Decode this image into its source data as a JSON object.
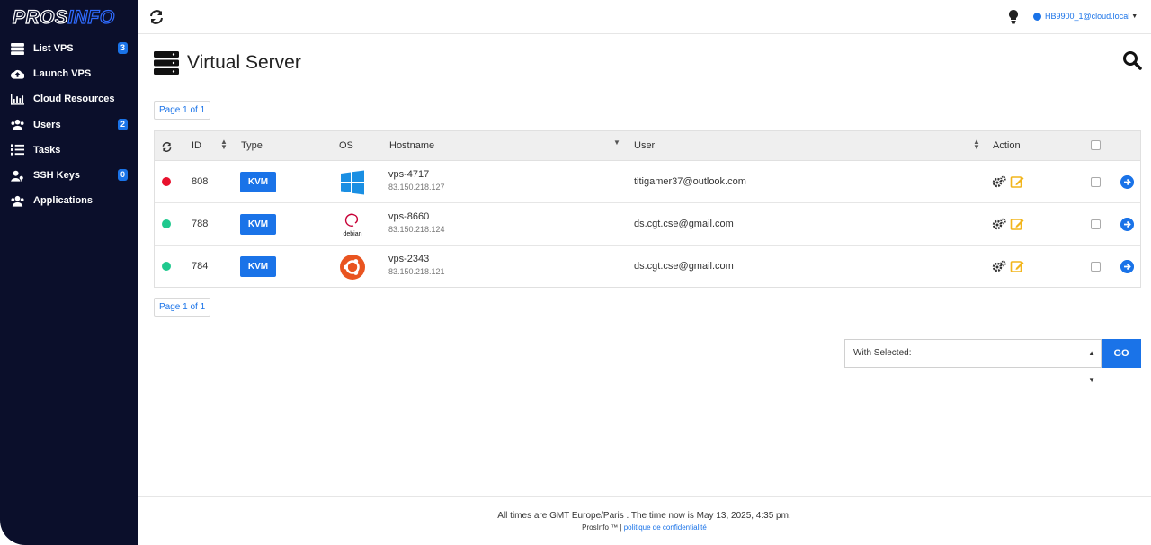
{
  "logo": {
    "part1": "PROS",
    "part2": "INFO"
  },
  "sidebar": {
    "items": [
      {
        "label": "List VPS",
        "icon": "server-icon",
        "badge": "3"
      },
      {
        "label": "Launch VPS",
        "icon": "cloud-upload-icon",
        "badge": ""
      },
      {
        "label": "Cloud Resources",
        "icon": "bar-chart-icon",
        "badge": ""
      },
      {
        "label": "Users",
        "icon": "users-icon",
        "badge": "2"
      },
      {
        "label": "Tasks",
        "icon": "list-icon",
        "badge": ""
      },
      {
        "label": "SSH Keys",
        "icon": "user-key-icon",
        "badge": "0"
      },
      {
        "label": "Applications",
        "icon": "users-icon",
        "badge": ""
      }
    ]
  },
  "topbar": {
    "user": "HB9900_1@cloud.local"
  },
  "page": {
    "title": "Virtual Server"
  },
  "pagination": {
    "top": "Page 1 of 1",
    "bottom": "Page 1 of 1"
  },
  "table": {
    "headers": {
      "id": "ID",
      "type": "Type",
      "os": "OS",
      "hostname": "Hostname",
      "user": "User",
      "action": "Action"
    },
    "rows": [
      {
        "status_color": "#e8112d",
        "id": "808",
        "type": "KVM",
        "os": "windows-logo",
        "hostname": "vps-4717",
        "ip": "83.150.218.127",
        "user": "titigamer37@outlook.com"
      },
      {
        "status_color": "#1fc98e",
        "id": "788",
        "type": "KVM",
        "os": "debian-logo",
        "os_label": "debian",
        "hostname": "vps-8660",
        "ip": "83.150.218.124",
        "user": "ds.cgt.cse@gmail.com"
      },
      {
        "status_color": "#1fc98e",
        "id": "784",
        "type": "KVM",
        "os": "ubuntu-logo",
        "hostname": "vps-2343",
        "ip": "83.150.218.121",
        "user": "ds.cgt.cse@gmail.com"
      }
    ]
  },
  "bulk": {
    "select_label": "With Selected:",
    "go_label": "GO"
  },
  "footer": {
    "line1": "All times are GMT Europe/Paris . The time now is May 13, 2025, 4:35 pm.",
    "brand": "ProsInfo ™",
    "separator": "|",
    "link": "politique de confidentialité"
  },
  "colors": {
    "accent": "#1a73e8",
    "sidebar": "#0b0f2b",
    "status_red": "#e8112d",
    "status_green": "#1fc98e",
    "edit": "#f2b51c"
  }
}
